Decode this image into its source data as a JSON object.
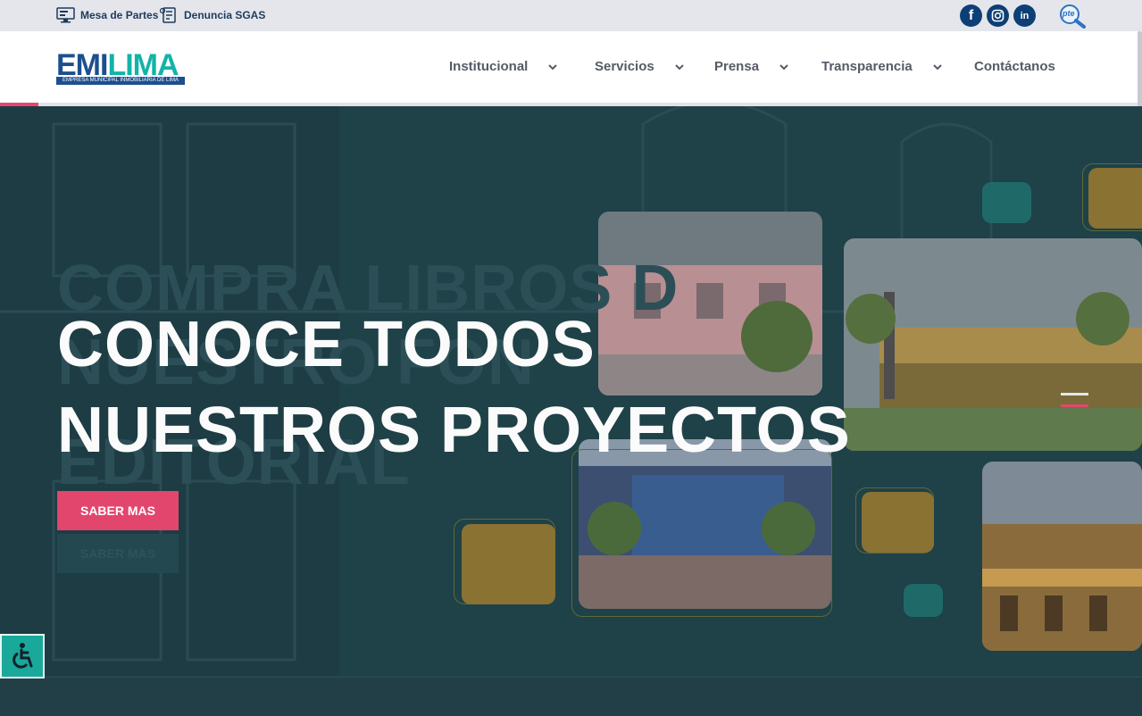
{
  "topbar": {
    "mesa_de_partes": "Mesa de Partes",
    "denuncia_sgas": "Denuncia SGAS",
    "social": {
      "facebook": "f",
      "instagram": "instagram-icon",
      "linkedin": "in"
    },
    "pte_label": "pte"
  },
  "logo": {
    "word_a": "EMI",
    "word_b": "LIMA",
    "subtitle": "EMPRESA MUNICIPAL INMOBILIARIA DE LIMA"
  },
  "nav": {
    "items": [
      {
        "label": "Institucional",
        "has_dropdown": true
      },
      {
        "label": "Servicios",
        "has_dropdown": true
      },
      {
        "label": "Prensa",
        "has_dropdown": true
      },
      {
        "label": "Transparencia",
        "has_dropdown": true
      },
      {
        "label": "Contáctanos",
        "has_dropdown": false
      }
    ]
  },
  "hero": {
    "headline_line1": "CONOCE TODOS",
    "headline_line2": "NUESTROS PROYECTOS",
    "ghost_line1": "COMPRA LIBROS D",
    "ghost_line2": "NUESTRO FON",
    "ghost_line3": "EDITORIAL",
    "cta_label": "SABER MAS",
    "cta_ghost_label": "SABER MAS"
  },
  "colors": {
    "brand_blue": "#1c4f8f",
    "brand_teal": "#12b3a8",
    "accent_pink": "#e3466d",
    "hero_bg": "#1f4148",
    "gold": "#b08a2c"
  },
  "accessibility": {
    "icon": "wheelchair-icon"
  }
}
